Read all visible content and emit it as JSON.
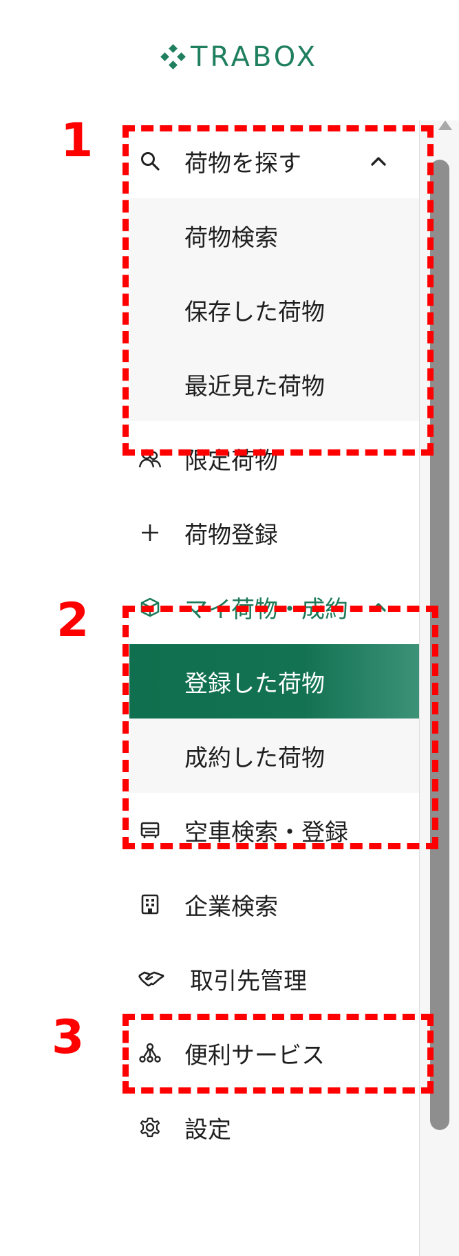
{
  "logo": {
    "text": "TRABOX",
    "color": "#1f7f5f"
  },
  "sidebar": {
    "cargo_search": {
      "label": "荷物を探す",
      "icon": "search-icon",
      "expanded": true,
      "children": [
        {
          "label": "荷物検索"
        },
        {
          "label": "保存した荷物"
        },
        {
          "label": "最近見た荷物"
        }
      ]
    },
    "limited_cargo": {
      "label": "限定荷物",
      "icon": "users-icon"
    },
    "cargo_register": {
      "label": "荷物登録",
      "icon": "plus-icon"
    },
    "my_cargo": {
      "label": "マイ荷物・成約",
      "icon": "box-icon",
      "expanded": true,
      "active": true,
      "children": [
        {
          "label": "登録した荷物",
          "selected": true
        },
        {
          "label": "成約した荷物"
        }
      ]
    },
    "empty_truck": {
      "label": "空車検索・登録",
      "icon": "truck-icon"
    },
    "company_search": {
      "label": "企業検索",
      "icon": "building-icon"
    },
    "partner_mgmt": {
      "label": "取引先管理",
      "icon": "handshake-icon"
    },
    "services": {
      "label": "便利サービス",
      "icon": "network-icon"
    },
    "settings": {
      "label": "設定",
      "icon": "gear-icon"
    }
  },
  "annotations": [
    {
      "number": "1"
    },
    {
      "number": "2"
    },
    {
      "number": "3"
    }
  ],
  "colors": {
    "accent": "#1d7a58",
    "selected_bg": "#0f6f4e",
    "annotation": "#ff0000"
  }
}
